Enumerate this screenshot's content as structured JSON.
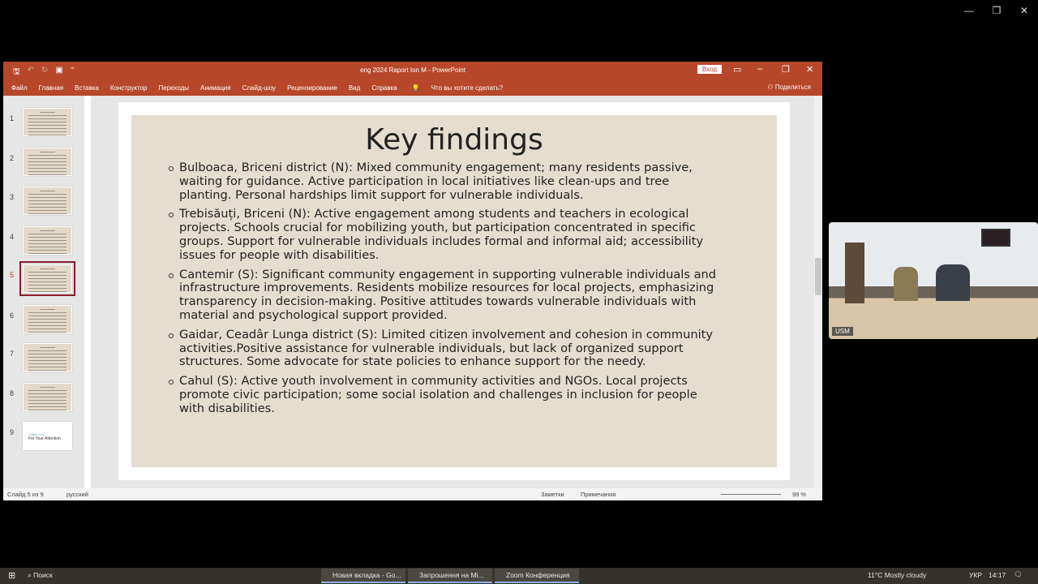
{
  "window": {
    "title": "eng 2024 Raport Ion M  -  PowerPoint",
    "login": "Вход",
    "share": "Поделиться",
    "accent": "#b7472a"
  },
  "ribbon": {
    "tabs": [
      "Файл",
      "Главная",
      "Вставка",
      "Конструктор",
      "Переходы",
      "Анимация",
      "Слайд-шоу",
      "Рецензирование",
      "Вид",
      "Справка"
    ],
    "search": "Что вы хотите сделать?"
  },
  "thumbnails": {
    "count": [
      1,
      2,
      3,
      4,
      5,
      6,
      7,
      8,
      9
    ],
    "selected": 5,
    "last_text": [
      "Thank You",
      "For Your Attention"
    ]
  },
  "slide": {
    "title": "Key findings",
    "bullets": [
      [
        "Bulboaca, Briceni district (N): Mixed community engagement; many residents passive,",
        "waiting for guidance. Active participation in local initiatives like clean-ups and tree",
        "planting. Personal hardships limit support for vulnerable individuals."
      ],
      [
        "Trebisăuți, Briceni (N): Active engagement among students and teachers in ecological",
        "projects. Schools crucial for mobilizing youth, but participation concentrated in specific",
        "groups. Support for vulnerable individuals includes formal and informal aid; accessibility",
        "issues for people with disabilities."
      ],
      [
        "Cantemir (S): Significant community engagement in supporting vulnerable individuals and",
        "infrastructure improvements. Residents mobilize resources for local projects, emphasizing",
        "transparency in decision-making. Positive attitudes towards vulnerable individuals with",
        "material and psychological support provided."
      ],
      [
        "Gaidar, Ceadâr Lunga district (S): Limited citizen involvement and cohesion in community",
        "activities.Positive assistance for vulnerable individuals, but lack of organized support",
        "structures. Some advocate for state policies to enhance support for the needy."
      ],
      [
        "Cahul (S): Active youth involvement in community activities and NGOs. Local projects",
        "promote civic participation; some social isolation and challenges in inclusion for people",
        "with disabilities."
      ]
    ]
  },
  "status": {
    "slide": "Слайд 5 из 9",
    "lang": "русский",
    "notes": "Заметки",
    "comments": "Примечания",
    "zoom": "99 %"
  },
  "video": {
    "label": "USM"
  },
  "taskbar": {
    "search": "Поиск",
    "tasks": [
      "Новая вкладка - Go...",
      "Запрошення на Mi...",
      "Zoom Конференция"
    ],
    "weather": "11°C  Mostly cloudy",
    "lang": "УКР",
    "time": "14:17"
  }
}
